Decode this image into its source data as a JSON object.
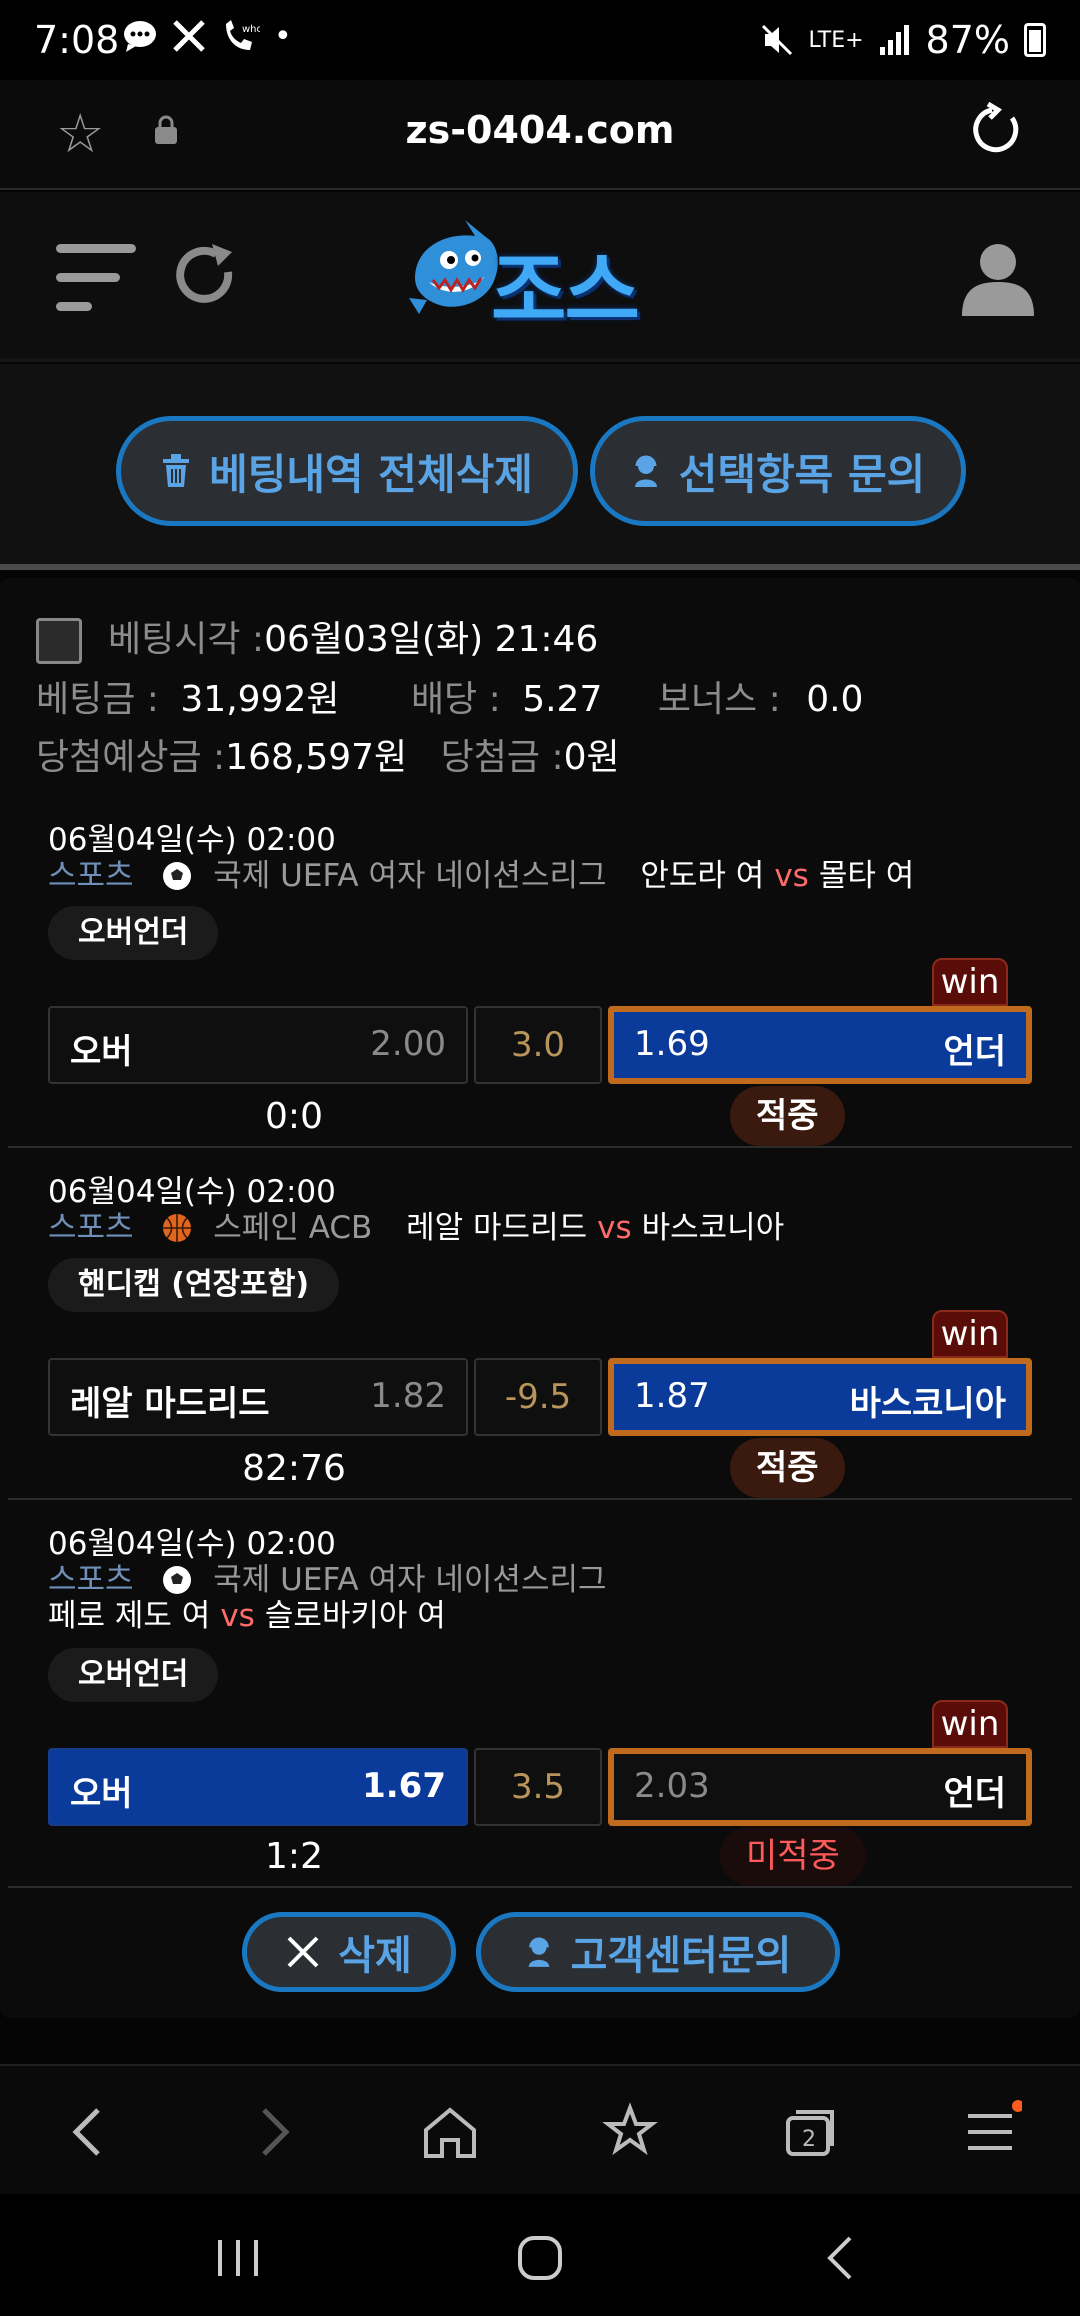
{
  "status": {
    "time": "7:08",
    "network": "LTE+",
    "battery": "87%"
  },
  "browser": {
    "url": "zs-0404.com"
  },
  "site": {
    "logo_text": "조스"
  },
  "actions": {
    "delete_all_label": "베팅내역 전체삭제",
    "inquiry_selected_label": "선택항목 문의"
  },
  "summary": {
    "bet_time_label": "베팅시각 :",
    "bet_time_value": "06월03일(화) 21:46",
    "amount_label": "베팅금 :",
    "amount_value": "31,992원",
    "odds_label": "배당 :",
    "odds_value": "5.27",
    "bonus_label": "보너스 :",
    "bonus_value": "0.0",
    "expected_label": "당첨예상금 :",
    "expected_value": "168,597원",
    "won_label": "당첨금 :",
    "won_value": "0원"
  },
  "matches": [
    {
      "datetime": "06월04일(수) 02:00",
      "category": "스포츠",
      "sport_icon": "soccer-ball-icon",
      "league": "국제 UEFA 여자 네이션스리그",
      "home": "안도라 여",
      "vs": "vs",
      "away": "몰타 여",
      "market": "오버언더",
      "left_label": "오버",
      "left_odds": "2.00",
      "line": "3.0",
      "right_odds": "1.69",
      "right_label": "언더",
      "win_tag": "win",
      "score": "0:0",
      "result": "적중"
    },
    {
      "datetime": "06월04일(수) 02:00",
      "category": "스포츠",
      "sport_icon": "basketball-icon",
      "league": "스페인 ACB",
      "home": "레알 마드리드",
      "vs": "vs",
      "away": "바스코니아",
      "market": "핸디캡 (연장포함)",
      "left_label": "레알 마드리드",
      "left_odds": "1.82",
      "line": "-9.5",
      "right_odds": "1.87",
      "right_label": "바스코니아",
      "win_tag": "win",
      "score": "82:76",
      "result": "적중"
    },
    {
      "datetime": "06월04일(수) 02:00",
      "category": "스포츠",
      "sport_icon": "soccer-ball-icon",
      "league": "국제 UEFA 여자 네이션스리그",
      "home": "페로 제도 여",
      "vs": "vs",
      "away": "슬로바키아 여",
      "market": "오버언더",
      "left_label": "오버",
      "left_odds": "1.67",
      "line": "3.5",
      "right_odds": "2.03",
      "right_label": "언더",
      "win_tag": "win",
      "score": "1:2",
      "result": "미적중"
    }
  ],
  "bottom": {
    "delete_label": "삭제",
    "support_label": "고객센터문의"
  },
  "colors": {
    "accent_blue": "#1a78c2",
    "selected_bg": "#0a3a9a",
    "win_border": "#c06a1e",
    "miss_text": "#ff5a5a"
  }
}
